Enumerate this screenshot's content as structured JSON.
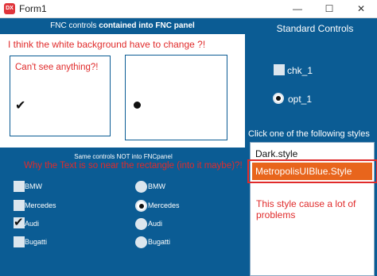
{
  "window": {
    "title": "Form1",
    "icon_text": "DX",
    "minimize": "—",
    "maximize": "☐",
    "close": "✕"
  },
  "fnc": {
    "header_prefix": "FNC controls",
    "header_bold": "contained into FNC panel",
    "note": "I think the white background have to change ?!",
    "box_note": "Can't see anything?!"
  },
  "standard": {
    "header": "Standard Controls",
    "checkbox_label": "chk_1",
    "radio_label": "opt_1"
  },
  "styles": {
    "prompt": "Click one of the following styles",
    "items": [
      "Dark.style",
      "MetropolisUIBlue.Style"
    ],
    "selected_index": 1,
    "selected_bg": "#e8651c",
    "note": "This style cause a lot of problems"
  },
  "same_controls": {
    "header": "Same controls NOT into FNCpanel",
    "note": "Why the Text is so near the rectangle (into it maybe)?!",
    "checkboxes": [
      {
        "label": "BMW",
        "checked": false
      },
      {
        "label": "Mercedes",
        "checked": false
      },
      {
        "label": "Audi",
        "checked": true
      },
      {
        "label": "Bugatti",
        "checked": false
      }
    ],
    "radios": [
      {
        "label": "BMW",
        "selected": false
      },
      {
        "label": "Mercedes",
        "selected": true
      },
      {
        "label": "Audi",
        "selected": false
      },
      {
        "label": "Bugatti",
        "selected": false
      }
    ]
  },
  "colors": {
    "panel_blue": "#0b5c94",
    "accent_red": "#e02b2b",
    "selected_orange": "#e8651c"
  }
}
